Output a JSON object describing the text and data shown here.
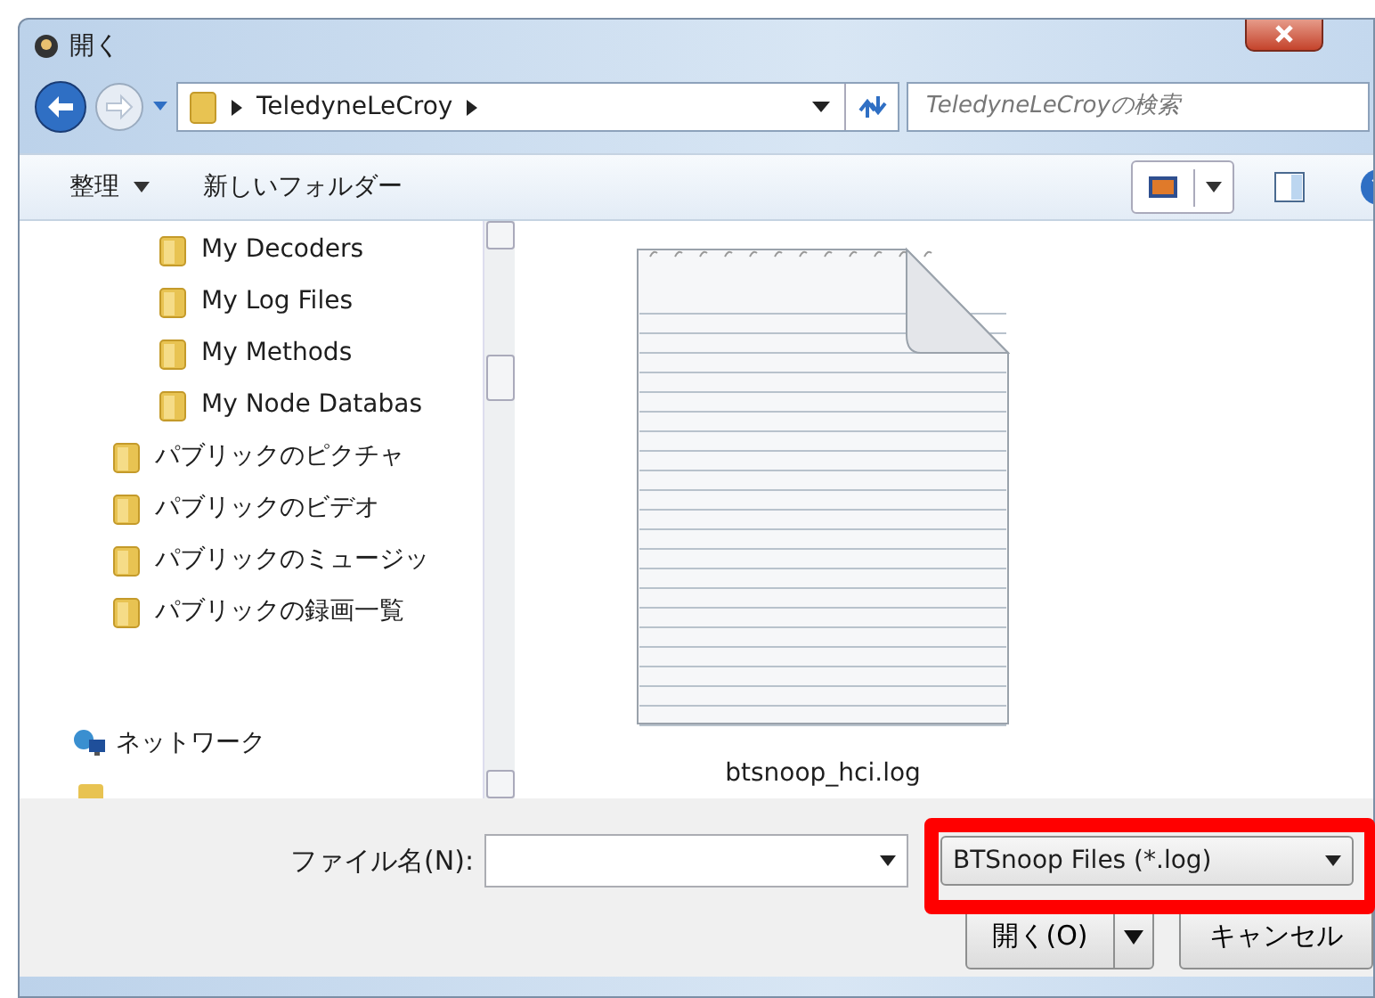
{
  "window": {
    "title": "開く"
  },
  "address_bar": {
    "path": [
      "TeledyneLeCroy"
    ]
  },
  "search": {
    "placeholder": "TeledyneLeCroyの検索"
  },
  "toolbar": {
    "organize": "整理",
    "new_folder": "新しいフォルダー"
  },
  "tree": [
    {
      "children": [
        {
          "label": "My Decoders"
        },
        {
          "label": "My Log Files"
        },
        {
          "label": "My Methods"
        },
        {
          "label": "My Node Databas"
        }
      ]
    },
    {
      "label": "パブリックのピクチャ"
    },
    {
      "label": "パブリックのビデオ"
    },
    {
      "label": "パブリックのミュージッ"
    },
    {
      "label": "パブリックの録画一覧"
    }
  ],
  "network": {
    "label": "ネットワーク"
  },
  "files": [
    {
      "name": "btsnoop_hci.log"
    }
  ],
  "file_name": {
    "label": "ファイル名(N):"
  },
  "file_type": {
    "value": "BTSnoop Files (*.log)",
    "highlighted": true
  },
  "buttons": {
    "open": "開く(O)",
    "cancel": "キャンセル"
  }
}
